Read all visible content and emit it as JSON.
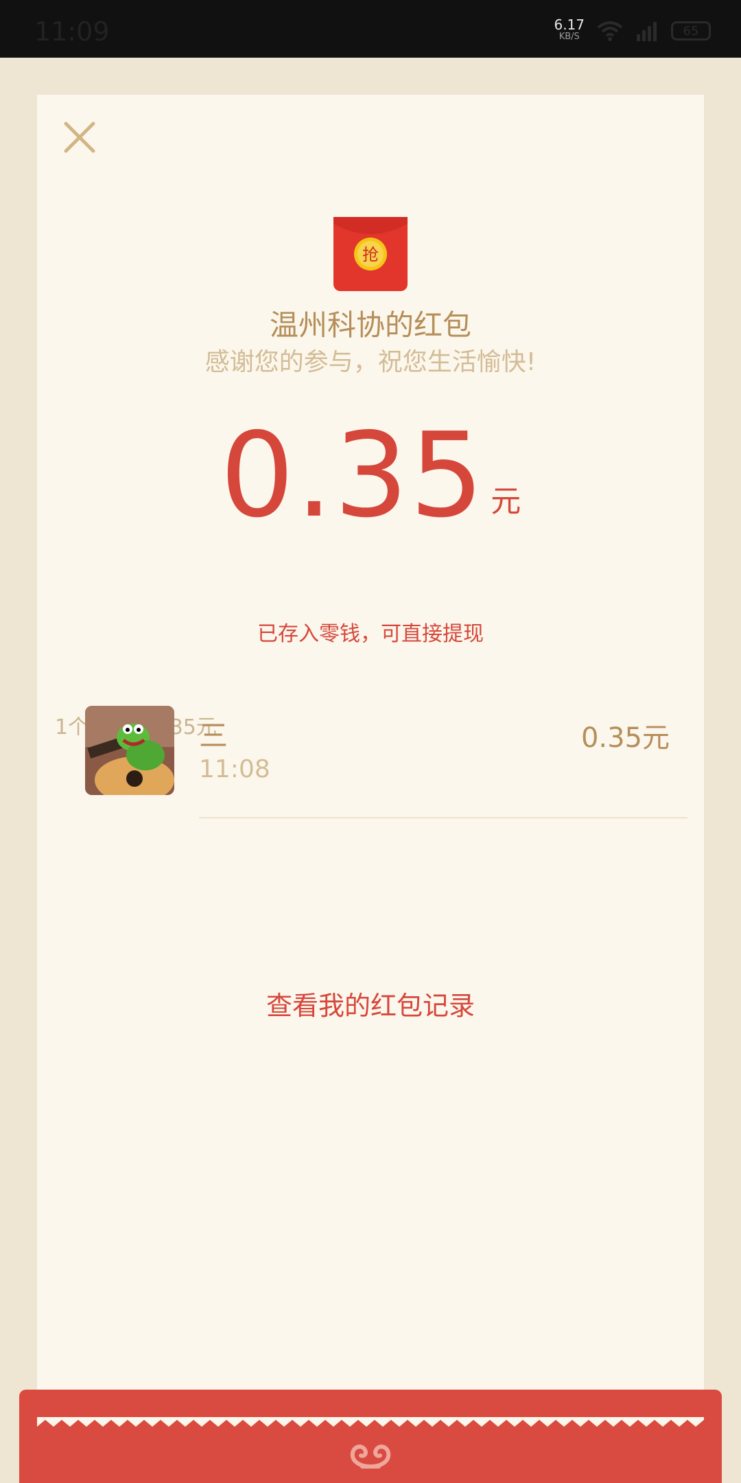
{
  "status_bar": {
    "time": "11:09",
    "net_speed": "6.17",
    "net_unit": "KB/S",
    "battery": "65"
  },
  "redpacket": {
    "sender_title": "温州科协的红包",
    "blessing": "感谢您的参与，祝您生活愉快!",
    "amount": "0.35",
    "amount_unit": "元",
    "saved_note": "已存入零钱，可直接提现",
    "summary": "1个红包共0.35元",
    "envelope_char": "抢"
  },
  "records": [
    {
      "name": "三",
      "time": "11:08",
      "amount": "0.35元"
    }
  ],
  "actions": {
    "view_records": "查看我的红包记录"
  },
  "colors": {
    "accent_red": "#D6473B",
    "gold": "#B58E5A",
    "card_bg": "#FCF7EC",
    "page_bg": "#EEE5D3"
  },
  "icons": [
    "close-icon",
    "red-envelope-icon",
    "wifi-icon",
    "signal-icon",
    "battery-icon",
    "cloud-logo-icon"
  ]
}
